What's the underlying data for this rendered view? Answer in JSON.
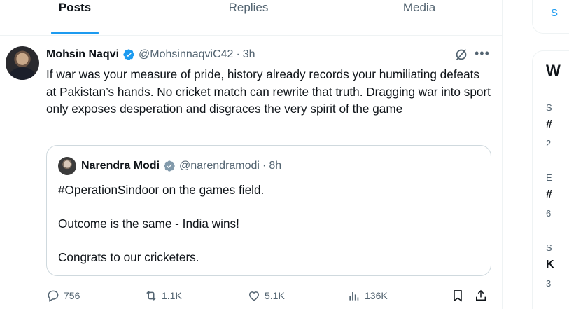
{
  "tabs": [
    {
      "label": "Posts",
      "active": true
    },
    {
      "label": "Replies",
      "active": false
    },
    {
      "label": "Media",
      "active": false
    }
  ],
  "post": {
    "author_name": "Mohsin Naqvi",
    "author_handle": "@MohsinnaqviC42",
    "separator": "·",
    "time": "3h",
    "text": "If war was your measure of pride, history already records your humiliating defeats at Pakistan’s hands. No cricket match can rewrite that truth. Dragging war into sport only exposes desperation and disgraces the very spirit of the game",
    "icons": {
      "verified": "verified-badge-icon",
      "grok": "grok-icon",
      "more": "more-icon"
    },
    "quote": {
      "author_name": "Narendra Modi",
      "author_handle": "@narendramodi",
      "separator": "·",
      "time": "8h",
      "line1": "#OperationSindoor on the games field.",
      "line2": "Outcome is the same - India wins!",
      "line3": "Congrats to our cricketers.",
      "verified_badge": "gray-verified-badge-icon"
    },
    "actions": {
      "replies": "756",
      "reposts": "1.1K",
      "likes": "5.1K",
      "views": "136K"
    }
  },
  "sidebar": {
    "search_glyph": "S",
    "title": "W",
    "items": [
      {
        "meta": "S",
        "tag": "#",
        "count": "2"
      },
      {
        "meta": "E",
        "tag": "#",
        "count": "6"
      },
      {
        "meta": "S",
        "tag": "K",
        "count": "3"
      }
    ]
  },
  "colors": {
    "accent": "#1d9bf0",
    "text": "#0f1419",
    "secondary": "#536471",
    "border": "#cfd9de",
    "verified_blue": "#1d9bf0",
    "verified_gray": "#829aab"
  }
}
